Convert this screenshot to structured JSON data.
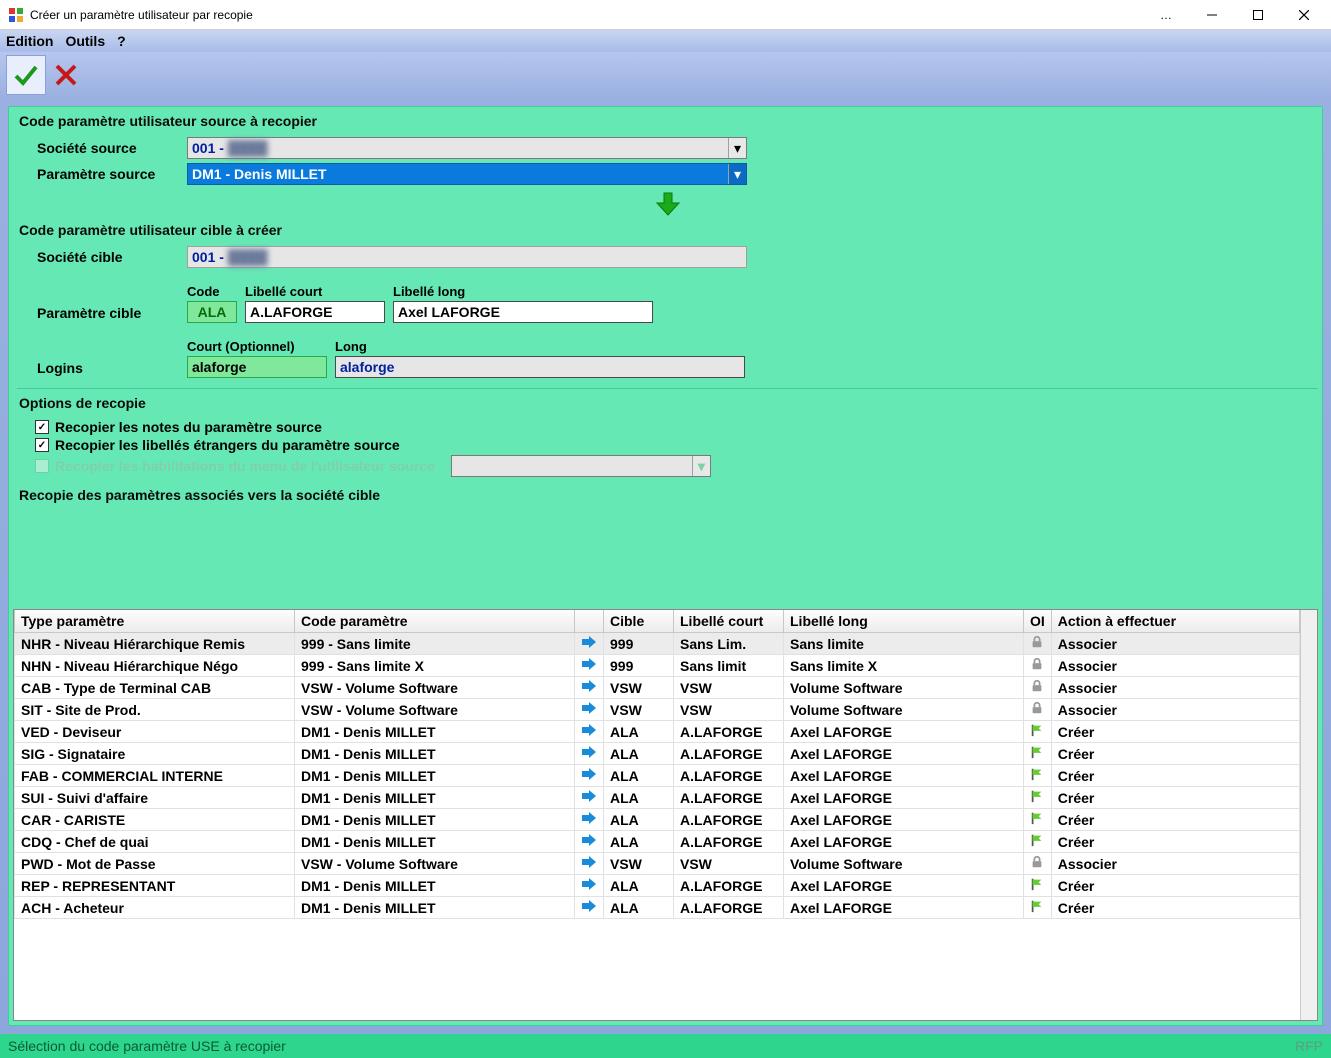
{
  "window": {
    "title": "Créer un paramètre utilisateur par recopie"
  },
  "menu": {
    "edition": "Edition",
    "outils": "Outils",
    "help": "?"
  },
  "section_source": {
    "title": "Code paramètre utilisateur source à recopier",
    "societe_label": "Société source",
    "societe_value": "001 -",
    "param_label": "Paramètre source",
    "param_value": "DM1 - Denis MILLET"
  },
  "section_cible": {
    "title": "Code paramètre utilisateur cible à créer",
    "societe_label": "Société cible",
    "societe_value": "001 -",
    "param_label": "Paramètre cible",
    "code_head": "Code",
    "code_value": "ALA",
    "libc_head": "Libellé court",
    "libc_value": "A.LAFORGE",
    "libl_head": "Libellé long",
    "libl_value": "Axel LAFORGE",
    "logins_label": "Logins",
    "login_c_head": "Court (Optionnel)",
    "login_c_value": "alaforge",
    "login_l_head": "Long",
    "login_l_value": "alaforge"
  },
  "options": {
    "title": "Options de recopie",
    "notes": "Recopier les notes du paramètre source",
    "libs": "Recopier les libellés étrangers du paramètre source",
    "habil": "Recopier les habilitations du menu de l'utilisateur source"
  },
  "assoc": {
    "title": "Recopie des paramètres associés vers la société cible",
    "headers": {
      "type": "Type paramètre",
      "code": "Code paramètre",
      "cible": "Cible",
      "libc": "Libellé court",
      "libl": "Libellé long",
      "oi": "OI",
      "action": "Action à effectuer"
    },
    "rows": [
      {
        "type": "NHR - Niveau Hiérarchique Remis",
        "code": "999 - Sans limite",
        "cible": "999",
        "libc": "Sans Lim.",
        "libl": "Sans limite",
        "icon": "lock",
        "action": "Associer",
        "sel": true
      },
      {
        "type": "NHN - Niveau Hiérarchique Négo",
        "code": "999 - Sans limite           X",
        "cible": "999",
        "libc": "Sans limit",
        "libl": "Sans limite             X",
        "icon": "lock",
        "action": "Associer"
      },
      {
        "type": "CAB - Type de Terminal CAB",
        "code": "VSW - Volume Software",
        "cible": "VSW",
        "libc": "VSW",
        "libl": "Volume Software",
        "icon": "lock",
        "action": "Associer"
      },
      {
        "type": "SIT - Site de Prod.",
        "code": "VSW - Volume Software",
        "cible": "VSW",
        "libc": "VSW",
        "libl": "Volume Software",
        "icon": "lock",
        "action": "Associer"
      },
      {
        "type": "VED - Deviseur",
        "code": "DM1 - Denis MILLET",
        "cible": "ALA",
        "libc": "A.LAFORGE",
        "libl": "Axel LAFORGE",
        "icon": "flag",
        "action": "Créer"
      },
      {
        "type": "SIG - Signataire",
        "code": "DM1 - Denis MILLET",
        "cible": "ALA",
        "libc": "A.LAFORGE",
        "libl": "Axel LAFORGE",
        "icon": "flag",
        "action": "Créer"
      },
      {
        "type": "FAB - COMMERCIAL INTERNE",
        "code": "DM1 - Denis MILLET",
        "cible": "ALA",
        "libc": "A.LAFORGE",
        "libl": "Axel LAFORGE",
        "icon": "flag",
        "action": "Créer"
      },
      {
        "type": "SUI - Suivi d'affaire",
        "code": "DM1 - Denis MILLET",
        "cible": "ALA",
        "libc": "A.LAFORGE",
        "libl": "Axel LAFORGE",
        "icon": "flag",
        "action": "Créer"
      },
      {
        "type": "CAR - CARISTE",
        "code": "DM1 - Denis MILLET",
        "cible": "ALA",
        "libc": "A.LAFORGE",
        "libl": "Axel LAFORGE",
        "icon": "flag",
        "action": "Créer"
      },
      {
        "type": "CDQ - Chef de quai",
        "code": "DM1 - Denis MILLET",
        "cible": "ALA",
        "libc": "A.LAFORGE",
        "libl": "Axel LAFORGE",
        "icon": "flag",
        "action": "Créer"
      },
      {
        "type": "PWD - Mot de Passe",
        "code": "VSW - Volume Software",
        "cible": "VSW",
        "libc": "VSW",
        "libl": "Volume Software",
        "icon": "lock",
        "action": "Associer"
      },
      {
        "type": "REP - REPRESENTANT",
        "code": "DM1 - Denis MILLET",
        "cible": "ALA",
        "libc": "A.LAFORGE",
        "libl": "Axel LAFORGE",
        "icon": "flag",
        "action": "Créer"
      },
      {
        "type": "ACH - Acheteur",
        "code": "DM1 - Denis MILLET",
        "cible": "ALA",
        "libc": "A.LAFORGE",
        "libl": "Axel LAFORGE",
        "icon": "flag",
        "action": "Créer"
      }
    ]
  },
  "status": {
    "left": "Sélection du code paramètre USE à recopier",
    "right": "RFP"
  }
}
